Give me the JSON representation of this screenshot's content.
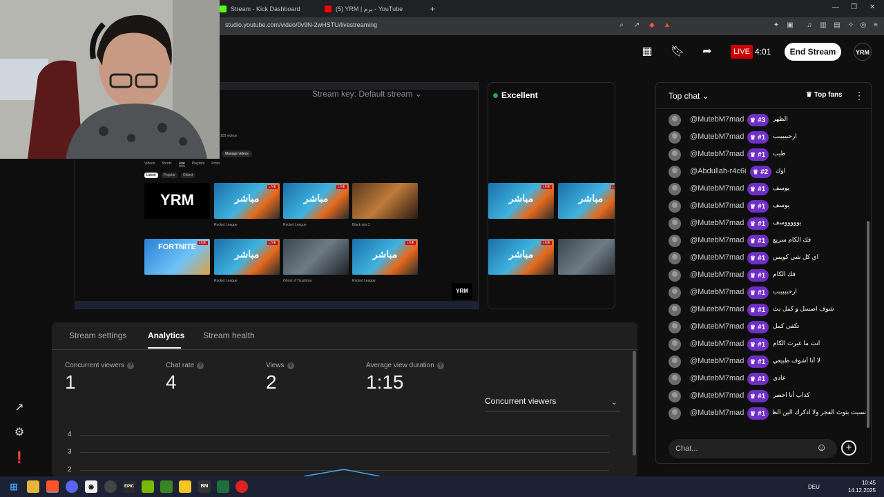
{
  "browser": {
    "tabs": [
      {
        "label": "Stream - Kick Dashboard",
        "color": "#53fc18"
      },
      {
        "label": "(5) YRM | يرم - YouTube",
        "color": "#ff0000"
      }
    ],
    "new_tab": "+",
    "url": "studio.youtube.com/video/0v9N-2wHSTU/livestreaming",
    "window_controls": [
      "—",
      "❐",
      "✕"
    ]
  },
  "header": {
    "live_label": "LIVE",
    "live_time": "4:01",
    "end_stream_label": "End Stream",
    "avatar_text": "YRM"
  },
  "preview": {
    "stream_key_label": "Stream key: Default stream",
    "quality_label": "Excellent",
    "thumb_text": "مباشر",
    "channel_logo": "YRM",
    "nav_tabs": [
      "Videos",
      "Shorts",
      "Live",
      "Playlists",
      "Posts"
    ],
    "sort_chips": [
      "Latest",
      "Popular",
      "Oldest"
    ],
    "game_labels": [
      "Rocket League",
      "Ghost of Tsushima",
      "Black ops 2",
      "FORTNITE"
    ],
    "videos_count": "105 videos",
    "manage_videos": "Manage videos"
  },
  "analytics": {
    "tabs": [
      "Stream settings",
      "Analytics",
      "Stream health"
    ],
    "active_tab": "Analytics",
    "metrics": [
      {
        "label": "Concurrent viewers",
        "value": "1"
      },
      {
        "label": "Chat rate",
        "value": "4"
      },
      {
        "label": "Views",
        "value": "2"
      },
      {
        "label": "Average view duration",
        "value": "1:15"
      }
    ],
    "metric_select": "Concurrent viewers",
    "y_ticks": [
      "4",
      "3",
      "2"
    ],
    "chart_line_color": "#3ea6ff"
  },
  "chat": {
    "title": "Top chat",
    "top_fans_label": "Top fans",
    "input_placeholder": "Chat...",
    "badge_color": "#6f2ec4",
    "messages": [
      {
        "author": "@MutebM7mad",
        "badge": "#3",
        "text": "الظهر"
      },
      {
        "author": "@MutebM7mad",
        "badge": "#1",
        "text": "ارحبيبيبب"
      },
      {
        "author": "@MutebM7mad",
        "badge": "#1",
        "text": "طيب"
      },
      {
        "author": "@Abdullah-r4c6i",
        "badge": "#2",
        "text": "اوك"
      },
      {
        "author": "@MutebM7mad",
        "badge": "#1",
        "text": "يوسف"
      },
      {
        "author": "@MutebM7mad",
        "badge": "#1",
        "text": "يوسف"
      },
      {
        "author": "@MutebM7mad",
        "badge": "#1",
        "text": "يوووووسف"
      },
      {
        "author": "@MutebM7mad",
        "badge": "#1",
        "text": "فك الكام سريع"
      },
      {
        "author": "@MutebM7mad",
        "badge": "#1",
        "text": "اي كل شي كويس"
      },
      {
        "author": "@MutebM7mad",
        "badge": "#1",
        "text": "فك الكام"
      },
      {
        "author": "@MutebM7mad",
        "badge": "#1",
        "text": "ارحبيبيبب"
      },
      {
        "author": "@MutebM7mad",
        "badge": "#1",
        "text": "شوف اصسل و كمل بث"
      },
      {
        "author": "@MutebM7mad",
        "badge": "#1",
        "text": "تكفى كمل"
      },
      {
        "author": "@MutebM7mad",
        "badge": "#1",
        "text": "انت ما غيرت الكام"
      },
      {
        "author": "@MutebM7mad",
        "badge": "#1",
        "text": "لا أنا أشوف طبيعي"
      },
      {
        "author": "@MutebM7mad",
        "badge": "#1",
        "text": "عادي"
      },
      {
        "author": "@MutebM7mad",
        "badge": "#1",
        "text": "كذاب أنا احضر"
      },
      {
        "author": "@MutebM7mad",
        "badge": "#1",
        "text": "نسيت بثوث الفجر ولا اذكرك الين الظهر"
      }
    ]
  },
  "taskbar": {
    "language": "DEU",
    "time": "10:45",
    "date": "14.12.2025"
  }
}
